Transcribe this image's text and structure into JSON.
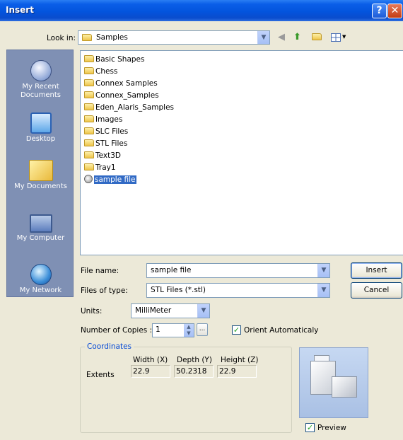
{
  "window": {
    "title": "Insert"
  },
  "titlebar": {
    "help_glyph": "?",
    "close_glyph": "✕"
  },
  "lookin": {
    "label": "Look in:",
    "value": "Samples"
  },
  "places": [
    {
      "label": "My Recent Documents",
      "icon": "recent-documents-icon"
    },
    {
      "label": "Desktop",
      "icon": "desktop-icon"
    },
    {
      "label": "My Documents",
      "icon": "my-documents-icon"
    },
    {
      "label": "My Computer",
      "icon": "my-computer-icon"
    },
    {
      "label": "My Network",
      "icon": "my-network-icon"
    }
  ],
  "files": [
    {
      "name": "Basic Shapes",
      "type": "folder"
    },
    {
      "name": "Chess",
      "type": "folder"
    },
    {
      "name": "Connex Samples",
      "type": "folder"
    },
    {
      "name": "Connex_Samples",
      "type": "folder"
    },
    {
      "name": "Eden_Alaris_Samples",
      "type": "folder"
    },
    {
      "name": "Images",
      "type": "folder"
    },
    {
      "name": "SLC Files",
      "type": "folder"
    },
    {
      "name": "STL Files",
      "type": "folder"
    },
    {
      "name": "Text3D",
      "type": "folder"
    },
    {
      "name": "Tray1",
      "type": "folder"
    },
    {
      "name": "sample file",
      "type": "file",
      "selected": true
    }
  ],
  "filename": {
    "label": "File name:",
    "value": "sample file"
  },
  "filetype": {
    "label": "Files of type:",
    "value": "STL Files (*.stl)"
  },
  "buttons": {
    "insert": "Insert",
    "cancel": "Cancel"
  },
  "units": {
    "label": "Units:",
    "value": "MilliMeter"
  },
  "copies": {
    "label": "Number of Copies :",
    "value": "1",
    "browse": "..."
  },
  "orient": {
    "label": "Orient Automaticaly",
    "checked": true
  },
  "coordinates": {
    "title": "Coordinates",
    "headers": [
      "Width (X)",
      "Depth (Y)",
      "Height (Z)"
    ],
    "row_label": "Extents",
    "values": [
      "22.9",
      "50.2318",
      "22.9"
    ]
  },
  "preview": {
    "label": "Preview",
    "checked": true
  },
  "colors": {
    "titlebar": "#0354dd",
    "places_bar": "#7f90b4",
    "selection": "#316ac5",
    "dialog_bg": "#ece9d8"
  }
}
